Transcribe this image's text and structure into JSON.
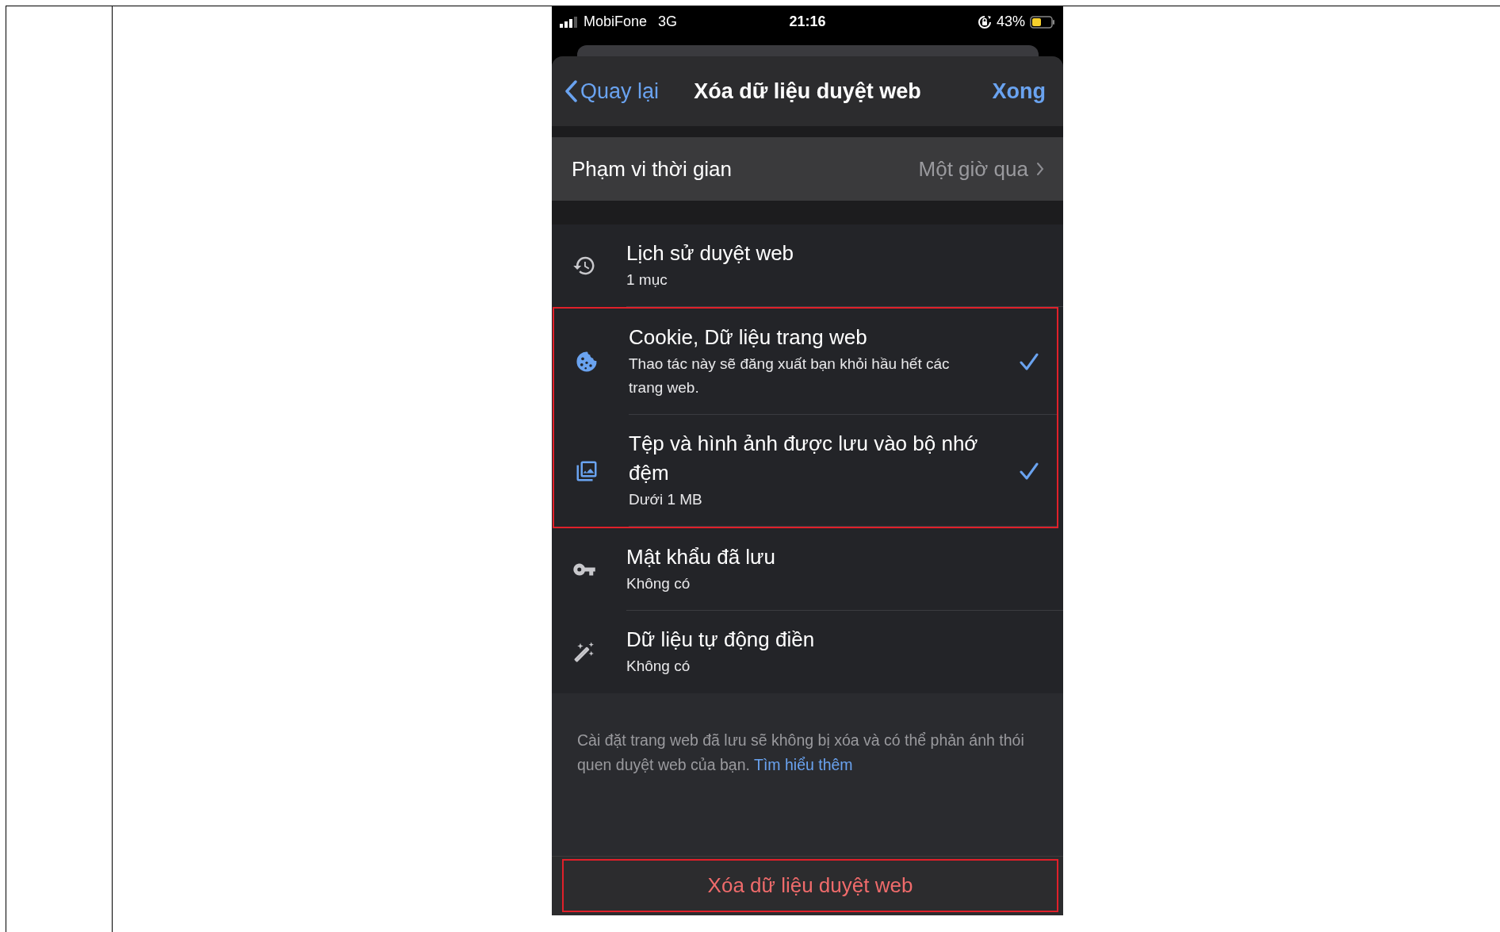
{
  "status_bar": {
    "carrier": "MobiFone",
    "network": "3G",
    "time": "21:16",
    "battery": "43%"
  },
  "nav_bar": {
    "back": "Quay lại",
    "title": "Xóa dữ liệu duyệt web",
    "done": "Xong"
  },
  "time_range": {
    "label": "Phạm vi thời gian",
    "value": "Một giờ qua"
  },
  "items": [
    {
      "title": "Lịch sử duyệt web",
      "subtitle": "1 mục",
      "checked": false,
      "highlighted": false
    },
    {
      "title": "Cookie, Dữ liệu trang web",
      "subtitle": "Thao tác này sẽ đăng xuất bạn khỏi hầu hết các trang web.",
      "checked": true,
      "highlighted": true
    },
    {
      "title": "Tệp và hình ảnh được lưu vào bộ nhớ đệm",
      "subtitle": "Dưới 1 MB",
      "checked": true,
      "highlighted": true
    },
    {
      "title": "Mật khẩu đã lưu",
      "subtitle": "Không có",
      "checked": false,
      "highlighted": false
    },
    {
      "title": "Dữ liệu tự động điền",
      "subtitle": "Không có",
      "checked": false,
      "highlighted": false
    }
  ],
  "footer": {
    "text": "Cài đặt trang web đã lưu sẽ không bị xóa và có thể phản ánh thói quen duyệt web của bạn.",
    "link": "Tìm hiểu thêm"
  },
  "clear_button": {
    "label": "Xóa dữ liệu duyệt web",
    "highlighted": true
  }
}
